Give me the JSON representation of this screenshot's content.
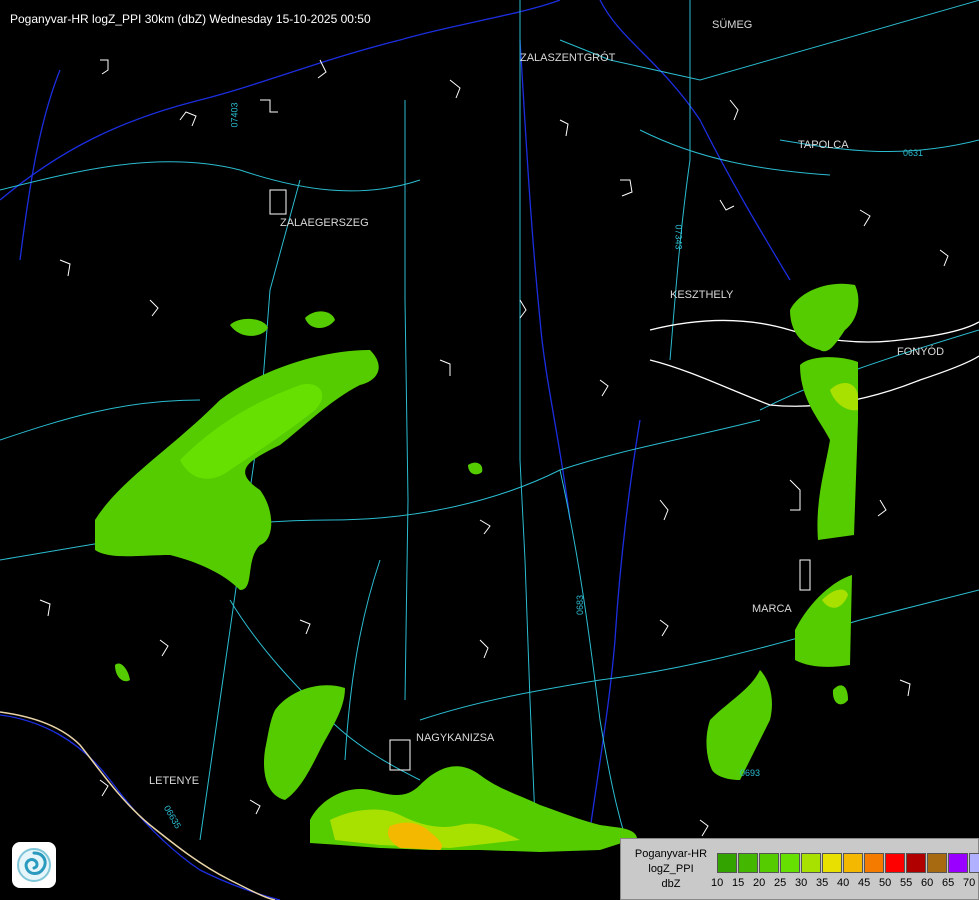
{
  "title": "Poganyvar-HR logZ_PPI 30km (dbZ) Wednesday 15-10-2025 00:50",
  "cities": [
    {
      "key": "sumeg",
      "name": "SÜMEG"
    },
    {
      "key": "zalaszentgrot",
      "name": "ZALASZENTGRÓT"
    },
    {
      "key": "tapolca",
      "name": "TAPOLCA"
    },
    {
      "key": "zalaegerszeg",
      "name": "ZALAEGERSZEG"
    },
    {
      "key": "keszthely",
      "name": "KESZTHELY"
    },
    {
      "key": "fonyod",
      "name": "FONYÓD"
    },
    {
      "key": "marcali",
      "name": "MARCA"
    },
    {
      "key": "nagykanizsa",
      "name": "NAGYKANIZSA"
    },
    {
      "key": "letenye",
      "name": "LETENYE"
    }
  ],
  "road_labels": [
    "07403",
    "07343",
    "0631",
    "0683",
    "0693",
    "06635"
  ],
  "legend": {
    "line1": "Poganyvar-HR",
    "line2": "logZ_PPI",
    "line3": "dbZ",
    "colors": [
      "#33a300",
      "#44b800",
      "#55cc00",
      "#66e000",
      "#a8e000",
      "#e8e000",
      "#f5b800",
      "#f57a00",
      "#ff0000",
      "#b00000",
      "#a86a10",
      "#9a00ff",
      "#b0b0ff"
    ],
    "ticks": [
      "10",
      "15",
      "20",
      "25",
      "30",
      "35",
      "40",
      "45",
      "50",
      "55",
      "60",
      "65",
      "70"
    ]
  },
  "colors": {
    "background": "#000000",
    "roads": "#2bbcd0",
    "rivers": "#1c2ee0",
    "borders": "#ffffff",
    "weak_echo": "#55cc00",
    "strong_echo": "#f5b800"
  }
}
